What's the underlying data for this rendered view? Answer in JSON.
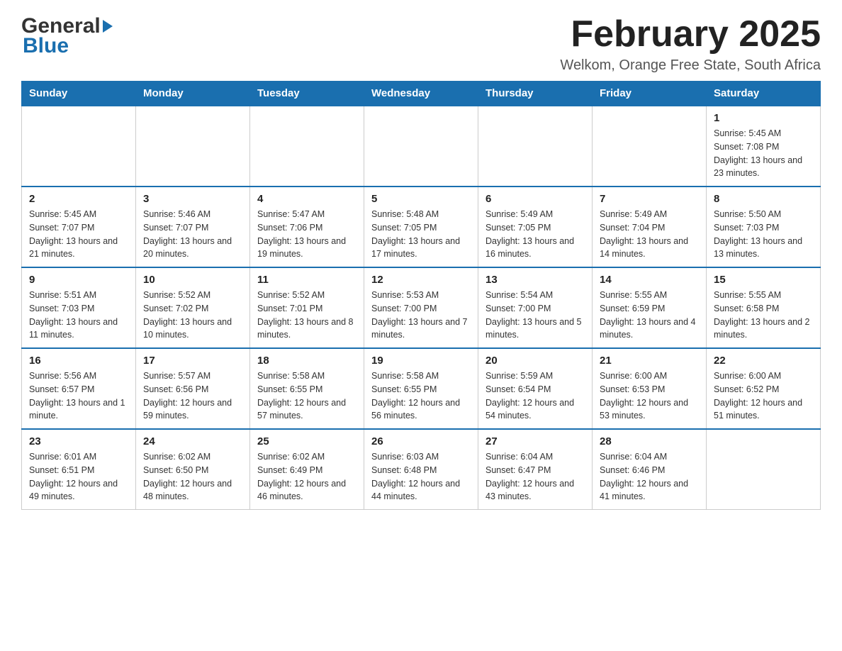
{
  "header": {
    "logo_general": "General",
    "logo_blue": "Blue",
    "title": "February 2025",
    "subtitle": "Welkom, Orange Free State, South Africa"
  },
  "days_of_week": [
    "Sunday",
    "Monday",
    "Tuesday",
    "Wednesday",
    "Thursday",
    "Friday",
    "Saturday"
  ],
  "weeks": [
    {
      "days": [
        {
          "number": "",
          "empty": true
        },
        {
          "number": "",
          "empty": true
        },
        {
          "number": "",
          "empty": true
        },
        {
          "number": "",
          "empty": true
        },
        {
          "number": "",
          "empty": true
        },
        {
          "number": "",
          "empty": true
        },
        {
          "number": "1",
          "sunrise": "5:45 AM",
          "sunset": "7:08 PM",
          "daylight": "13 hours and 23 minutes."
        }
      ]
    },
    {
      "days": [
        {
          "number": "2",
          "sunrise": "5:45 AM",
          "sunset": "7:07 PM",
          "daylight": "13 hours and 21 minutes."
        },
        {
          "number": "3",
          "sunrise": "5:46 AM",
          "sunset": "7:07 PM",
          "daylight": "13 hours and 20 minutes."
        },
        {
          "number": "4",
          "sunrise": "5:47 AM",
          "sunset": "7:06 PM",
          "daylight": "13 hours and 19 minutes."
        },
        {
          "number": "5",
          "sunrise": "5:48 AM",
          "sunset": "7:05 PM",
          "daylight": "13 hours and 17 minutes."
        },
        {
          "number": "6",
          "sunrise": "5:49 AM",
          "sunset": "7:05 PM",
          "daylight": "13 hours and 16 minutes."
        },
        {
          "number": "7",
          "sunrise": "5:49 AM",
          "sunset": "7:04 PM",
          "daylight": "13 hours and 14 minutes."
        },
        {
          "number": "8",
          "sunrise": "5:50 AM",
          "sunset": "7:03 PM",
          "daylight": "13 hours and 13 minutes."
        }
      ]
    },
    {
      "days": [
        {
          "number": "9",
          "sunrise": "5:51 AM",
          "sunset": "7:03 PM",
          "daylight": "13 hours and 11 minutes."
        },
        {
          "number": "10",
          "sunrise": "5:52 AM",
          "sunset": "7:02 PM",
          "daylight": "13 hours and 10 minutes."
        },
        {
          "number": "11",
          "sunrise": "5:52 AM",
          "sunset": "7:01 PM",
          "daylight": "13 hours and 8 minutes."
        },
        {
          "number": "12",
          "sunrise": "5:53 AM",
          "sunset": "7:00 PM",
          "daylight": "13 hours and 7 minutes."
        },
        {
          "number": "13",
          "sunrise": "5:54 AM",
          "sunset": "7:00 PM",
          "daylight": "13 hours and 5 minutes."
        },
        {
          "number": "14",
          "sunrise": "5:55 AM",
          "sunset": "6:59 PM",
          "daylight": "13 hours and 4 minutes."
        },
        {
          "number": "15",
          "sunrise": "5:55 AM",
          "sunset": "6:58 PM",
          "daylight": "13 hours and 2 minutes."
        }
      ]
    },
    {
      "days": [
        {
          "number": "16",
          "sunrise": "5:56 AM",
          "sunset": "6:57 PM",
          "daylight": "13 hours and 1 minute."
        },
        {
          "number": "17",
          "sunrise": "5:57 AM",
          "sunset": "6:56 PM",
          "daylight": "12 hours and 59 minutes."
        },
        {
          "number": "18",
          "sunrise": "5:58 AM",
          "sunset": "6:55 PM",
          "daylight": "12 hours and 57 minutes."
        },
        {
          "number": "19",
          "sunrise": "5:58 AM",
          "sunset": "6:55 PM",
          "daylight": "12 hours and 56 minutes."
        },
        {
          "number": "20",
          "sunrise": "5:59 AM",
          "sunset": "6:54 PM",
          "daylight": "12 hours and 54 minutes."
        },
        {
          "number": "21",
          "sunrise": "6:00 AM",
          "sunset": "6:53 PM",
          "daylight": "12 hours and 53 minutes."
        },
        {
          "number": "22",
          "sunrise": "6:00 AM",
          "sunset": "6:52 PM",
          "daylight": "12 hours and 51 minutes."
        }
      ]
    },
    {
      "days": [
        {
          "number": "23",
          "sunrise": "6:01 AM",
          "sunset": "6:51 PM",
          "daylight": "12 hours and 49 minutes."
        },
        {
          "number": "24",
          "sunrise": "6:02 AM",
          "sunset": "6:50 PM",
          "daylight": "12 hours and 48 minutes."
        },
        {
          "number": "25",
          "sunrise": "6:02 AM",
          "sunset": "6:49 PM",
          "daylight": "12 hours and 46 minutes."
        },
        {
          "number": "26",
          "sunrise": "6:03 AM",
          "sunset": "6:48 PM",
          "daylight": "12 hours and 44 minutes."
        },
        {
          "number": "27",
          "sunrise": "6:04 AM",
          "sunset": "6:47 PM",
          "daylight": "12 hours and 43 minutes."
        },
        {
          "number": "28",
          "sunrise": "6:04 AM",
          "sunset": "6:46 PM",
          "daylight": "12 hours and 41 minutes."
        },
        {
          "number": "",
          "empty": true
        }
      ]
    }
  ]
}
